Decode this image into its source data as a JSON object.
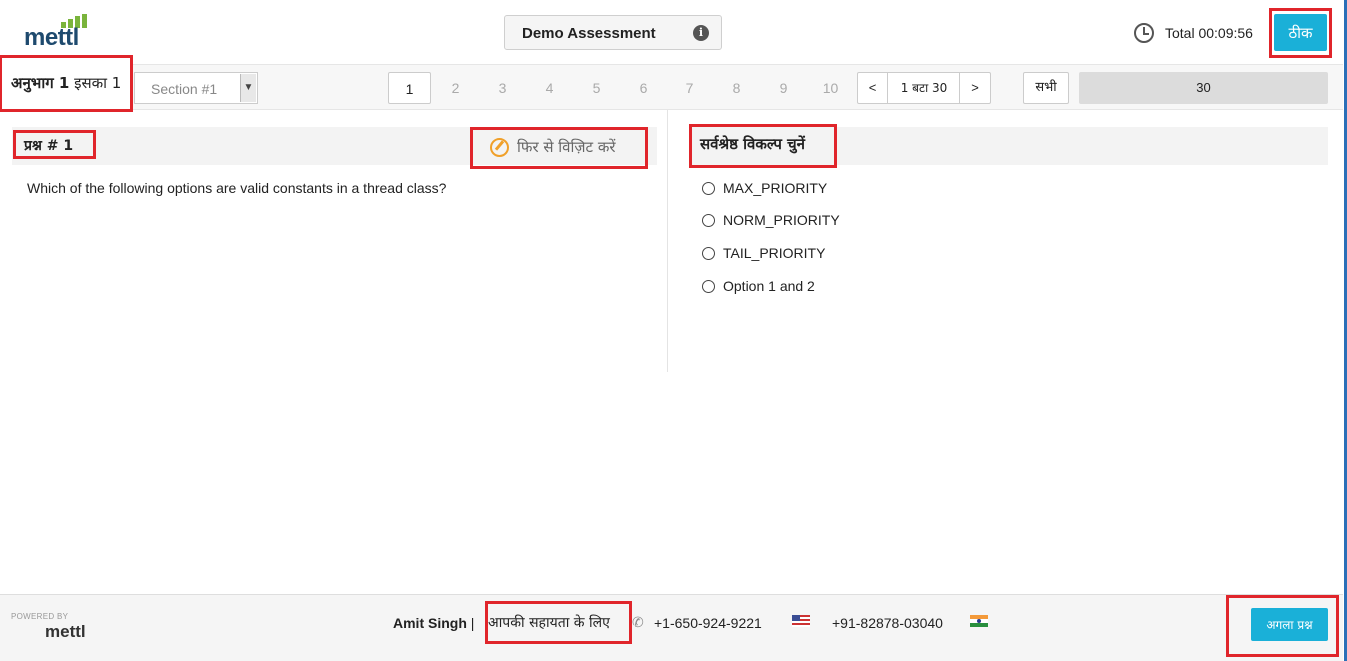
{
  "header": {
    "logo_text": "mettl",
    "assessment_title": "Demo Assessment",
    "timer_text": "Total 00:09:56",
    "ok_label": "ठीक"
  },
  "nav": {
    "section_prefix": "अनुभाग 1",
    "section_suffix": " इसका 1",
    "section_select_value": "Section #1",
    "question_numbers": [
      "1",
      "2",
      "3",
      "4",
      "5",
      "6",
      "7",
      "8",
      "9",
      "10"
    ],
    "active_question": "1",
    "pager_prev": "<",
    "pager_text": "1 बटा 30",
    "pager_next": ">",
    "all_label": "सभी",
    "total_count": "30"
  },
  "question": {
    "number_label": "प्रश्न # 1",
    "revisit_label": "फिर से विज़िट करें",
    "text": "Which of the following options are valid constants in a thread class?"
  },
  "answers": {
    "heading": "सर्वश्रेष्ठ विकल्प चुनें",
    "options": [
      "MAX_PRIORITY",
      "NORM_PRIORITY",
      "TAIL_PRIORITY",
      "Option 1 and 2"
    ]
  },
  "footer": {
    "powered_by": "POWERED BY",
    "powered_brand": "mettl",
    "contact_name": "Amit Singh",
    "separator": " | ",
    "help_text": "आपकी सहायता के लिए",
    "phone_us": "+1-650-924-9221",
    "phone_in": "+91-82878-03040",
    "next_label": "अगला प्रश्न"
  }
}
